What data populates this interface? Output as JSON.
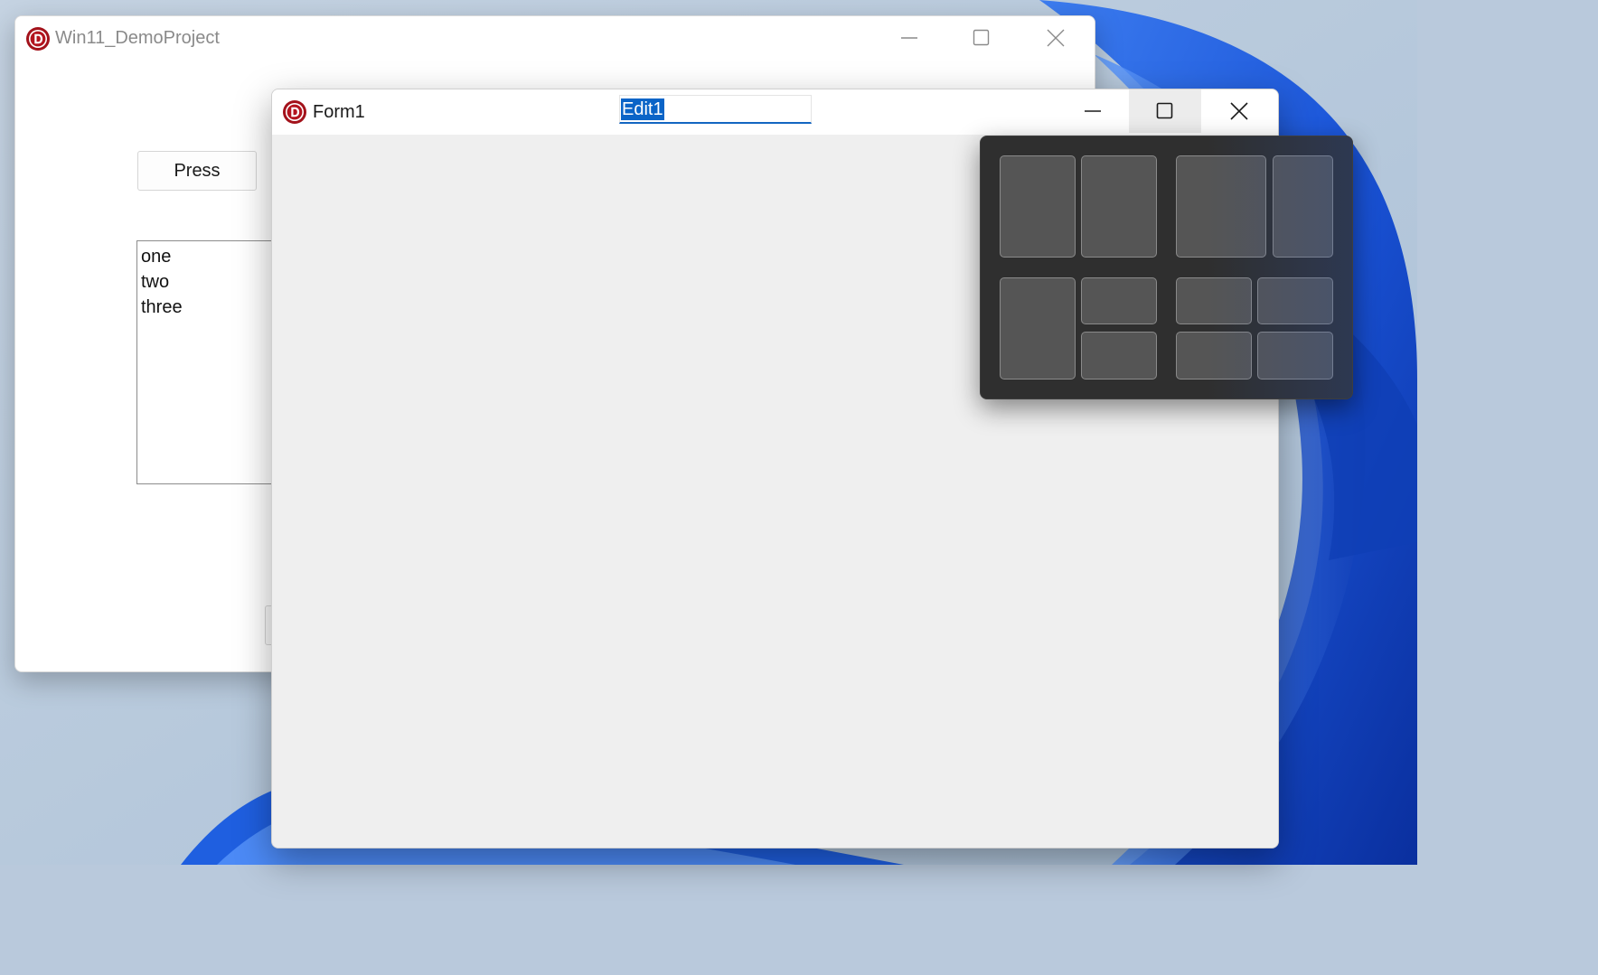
{
  "desktop": {
    "wallpaper": "windows-11-bloom",
    "accent": "#1c5be0"
  },
  "back_window": {
    "title": "Win11_DemoProject",
    "icon": "delphi-logo-icon",
    "caption_buttons": [
      "minimize-icon",
      "maximize-icon",
      "close-icon"
    ],
    "button_label": "Press",
    "memo_lines": [
      "one",
      "two",
      "three"
    ]
  },
  "front_window": {
    "title": "Form1",
    "icon": "delphi-logo-icon",
    "edit_value": "Edit1",
    "caption_buttons": [
      "minimize-icon",
      "maximize-icon",
      "close-icon"
    ],
    "hovered_button": "maximize"
  },
  "snap_layouts": {
    "background": "#2f2f2f",
    "layouts": [
      {
        "name": "two-equal-columns",
        "zones": 2
      },
      {
        "name": "wide-narrow-columns",
        "zones": 2
      },
      {
        "name": "column-plus-two-stacked",
        "zones": 3
      },
      {
        "name": "four-quadrants",
        "zones": 4
      }
    ]
  }
}
